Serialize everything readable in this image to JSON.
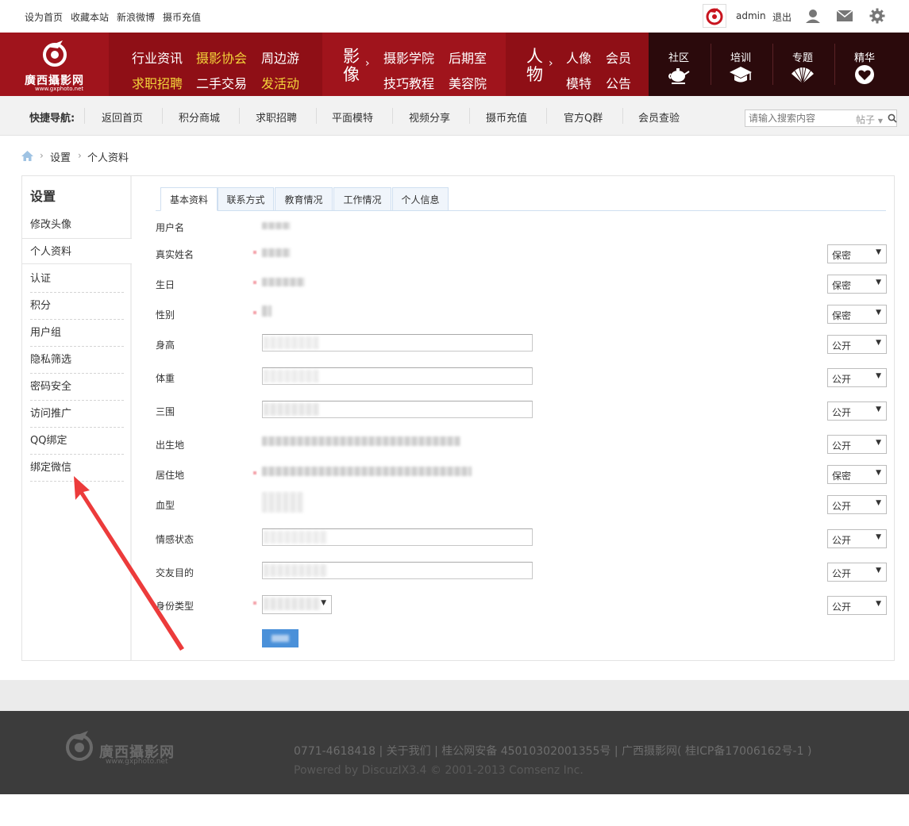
{
  "topbar": {
    "links": [
      "设为首页",
      "收藏本站",
      "新浪微博",
      "摄币充值"
    ],
    "username": "admin",
    "logout": "退出"
  },
  "banner": {
    "logo_text": "廣西攝影网",
    "logo_url_text": "www.gxphoto.net",
    "group1": {
      "row1": [
        "行业资讯",
        "摄影协会",
        "周边游"
      ],
      "row2": [
        "求职招聘",
        "二手交易",
        "发活动"
      ]
    },
    "group2": {
      "big": [
        "影",
        "像"
      ],
      "row1": [
        "摄影学院",
        "后期室"
      ],
      "row2": [
        "技巧教程",
        "美容院"
      ]
    },
    "group3": {
      "big": [
        "人",
        "物"
      ],
      "row1": [
        "人像",
        "会员"
      ],
      "row2": [
        "模特",
        "公告"
      ]
    },
    "cells": [
      "社区",
      "培训",
      "专题",
      "精华"
    ],
    "colors": {
      "red": "#a0141c",
      "dark_red": "#8f0f16",
      "dark": "#2b0a0c",
      "yellow": "#f3d33a"
    }
  },
  "quicknav": {
    "label": "快捷导航:",
    "items": [
      "返回首页",
      "积分商城",
      "求职招聘",
      "平面模特",
      "视频分享",
      "摄币充值",
      "官方Q群",
      "会员查验"
    ],
    "search_placeholder": "请输入搜索内容",
    "search_type": "帖子"
  },
  "breadcrumb": [
    "设置",
    "个人资料"
  ],
  "sidebar": {
    "title": "设置",
    "items": [
      "修改头像",
      "个人资料",
      "认证",
      "积分",
      "用户组",
      "隐私筛选",
      "密码安全",
      "访问推广",
      "QQ绑定",
      "绑定微信"
    ],
    "active_index": 1
  },
  "tabs": [
    "基本资料",
    "联系方式",
    "教育情况",
    "工作情况",
    "个人信息"
  ],
  "form": {
    "rows": [
      {
        "label": "用户名",
        "privacy": ""
      },
      {
        "label": "真实姓名",
        "privacy": "保密"
      },
      {
        "label": "生日",
        "privacy": "保密"
      },
      {
        "label": "性别",
        "privacy": "保密"
      },
      {
        "label": "身高",
        "privacy": "公开"
      },
      {
        "label": "体重",
        "privacy": "公开"
      },
      {
        "label": "三围",
        "privacy": "公开"
      },
      {
        "label": "出生地",
        "privacy": "公开"
      },
      {
        "label": "居住地",
        "privacy": "保密"
      },
      {
        "label": "血型",
        "privacy": "公开"
      },
      {
        "label": "情感状态",
        "privacy": "公开"
      },
      {
        "label": "交友目的",
        "privacy": "公开"
      },
      {
        "label": "身份类型",
        "privacy": "公开"
      }
    ]
  },
  "footer": {
    "logo_text": "廣西攝影网",
    "logo_url_text": "www.gxphoto.net",
    "line1": "0771-4618418  |  关于我们  |  桂公网安备 45010302001355号  |  广西摄影网( 桂ICP备17006162号-1 )",
    "line2": "Powered by DiscuzIX3.4 © 2001-2013 Comsenz Inc."
  }
}
